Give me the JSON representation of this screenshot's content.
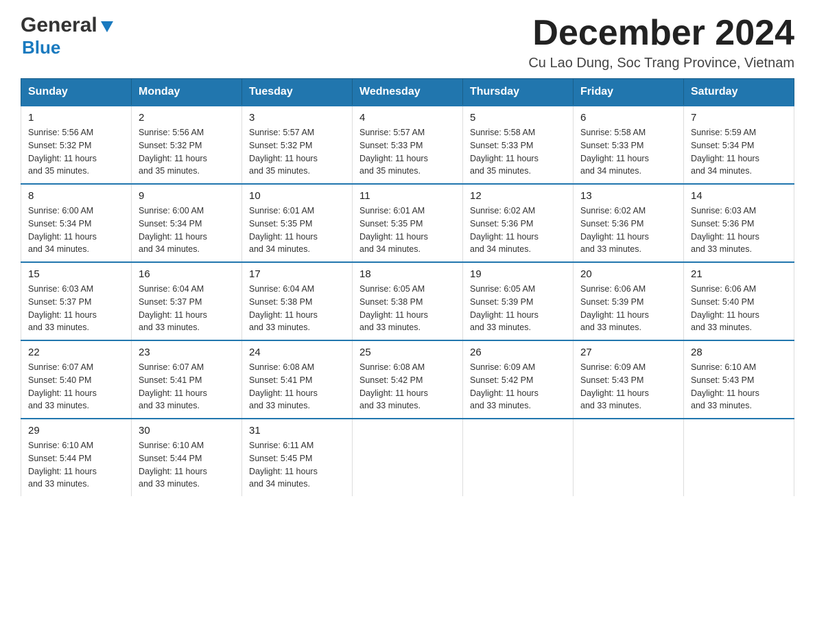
{
  "header": {
    "logo_general": "General",
    "logo_blue": "Blue",
    "month_title": "December 2024",
    "location": "Cu Lao Dung, Soc Trang Province, Vietnam"
  },
  "calendar": {
    "days_of_week": [
      "Sunday",
      "Monday",
      "Tuesday",
      "Wednesday",
      "Thursday",
      "Friday",
      "Saturday"
    ],
    "weeks": [
      [
        {
          "day": "1",
          "sunrise": "5:56 AM",
          "sunset": "5:32 PM",
          "daylight": "11 hours and 35 minutes."
        },
        {
          "day": "2",
          "sunrise": "5:56 AM",
          "sunset": "5:32 PM",
          "daylight": "11 hours and 35 minutes."
        },
        {
          "day": "3",
          "sunrise": "5:57 AM",
          "sunset": "5:32 PM",
          "daylight": "11 hours and 35 minutes."
        },
        {
          "day": "4",
          "sunrise": "5:57 AM",
          "sunset": "5:33 PM",
          "daylight": "11 hours and 35 minutes."
        },
        {
          "day": "5",
          "sunrise": "5:58 AM",
          "sunset": "5:33 PM",
          "daylight": "11 hours and 35 minutes."
        },
        {
          "day": "6",
          "sunrise": "5:58 AM",
          "sunset": "5:33 PM",
          "daylight": "11 hours and 34 minutes."
        },
        {
          "day": "7",
          "sunrise": "5:59 AM",
          "sunset": "5:34 PM",
          "daylight": "11 hours and 34 minutes."
        }
      ],
      [
        {
          "day": "8",
          "sunrise": "6:00 AM",
          "sunset": "5:34 PM",
          "daylight": "11 hours and 34 minutes."
        },
        {
          "day": "9",
          "sunrise": "6:00 AM",
          "sunset": "5:34 PM",
          "daylight": "11 hours and 34 minutes."
        },
        {
          "day": "10",
          "sunrise": "6:01 AM",
          "sunset": "5:35 PM",
          "daylight": "11 hours and 34 minutes."
        },
        {
          "day": "11",
          "sunrise": "6:01 AM",
          "sunset": "5:35 PM",
          "daylight": "11 hours and 34 minutes."
        },
        {
          "day": "12",
          "sunrise": "6:02 AM",
          "sunset": "5:36 PM",
          "daylight": "11 hours and 34 minutes."
        },
        {
          "day": "13",
          "sunrise": "6:02 AM",
          "sunset": "5:36 PM",
          "daylight": "11 hours and 33 minutes."
        },
        {
          "day": "14",
          "sunrise": "6:03 AM",
          "sunset": "5:36 PM",
          "daylight": "11 hours and 33 minutes."
        }
      ],
      [
        {
          "day": "15",
          "sunrise": "6:03 AM",
          "sunset": "5:37 PM",
          "daylight": "11 hours and 33 minutes."
        },
        {
          "day": "16",
          "sunrise": "6:04 AM",
          "sunset": "5:37 PM",
          "daylight": "11 hours and 33 minutes."
        },
        {
          "day": "17",
          "sunrise": "6:04 AM",
          "sunset": "5:38 PM",
          "daylight": "11 hours and 33 minutes."
        },
        {
          "day": "18",
          "sunrise": "6:05 AM",
          "sunset": "5:38 PM",
          "daylight": "11 hours and 33 minutes."
        },
        {
          "day": "19",
          "sunrise": "6:05 AM",
          "sunset": "5:39 PM",
          "daylight": "11 hours and 33 minutes."
        },
        {
          "day": "20",
          "sunrise": "6:06 AM",
          "sunset": "5:39 PM",
          "daylight": "11 hours and 33 minutes."
        },
        {
          "day": "21",
          "sunrise": "6:06 AM",
          "sunset": "5:40 PM",
          "daylight": "11 hours and 33 minutes."
        }
      ],
      [
        {
          "day": "22",
          "sunrise": "6:07 AM",
          "sunset": "5:40 PM",
          "daylight": "11 hours and 33 minutes."
        },
        {
          "day": "23",
          "sunrise": "6:07 AM",
          "sunset": "5:41 PM",
          "daylight": "11 hours and 33 minutes."
        },
        {
          "day": "24",
          "sunrise": "6:08 AM",
          "sunset": "5:41 PM",
          "daylight": "11 hours and 33 minutes."
        },
        {
          "day": "25",
          "sunrise": "6:08 AM",
          "sunset": "5:42 PM",
          "daylight": "11 hours and 33 minutes."
        },
        {
          "day": "26",
          "sunrise": "6:09 AM",
          "sunset": "5:42 PM",
          "daylight": "11 hours and 33 minutes."
        },
        {
          "day": "27",
          "sunrise": "6:09 AM",
          "sunset": "5:43 PM",
          "daylight": "11 hours and 33 minutes."
        },
        {
          "day": "28",
          "sunrise": "6:10 AM",
          "sunset": "5:43 PM",
          "daylight": "11 hours and 33 minutes."
        }
      ],
      [
        {
          "day": "29",
          "sunrise": "6:10 AM",
          "sunset": "5:44 PM",
          "daylight": "11 hours and 33 minutes."
        },
        {
          "day": "30",
          "sunrise": "6:10 AM",
          "sunset": "5:44 PM",
          "daylight": "11 hours and 33 minutes."
        },
        {
          "day": "31",
          "sunrise": "6:11 AM",
          "sunset": "5:45 PM",
          "daylight": "11 hours and 34 minutes."
        },
        null,
        null,
        null,
        null
      ]
    ],
    "sunrise_label": "Sunrise:",
    "sunset_label": "Sunset:",
    "daylight_label": "Daylight:"
  }
}
